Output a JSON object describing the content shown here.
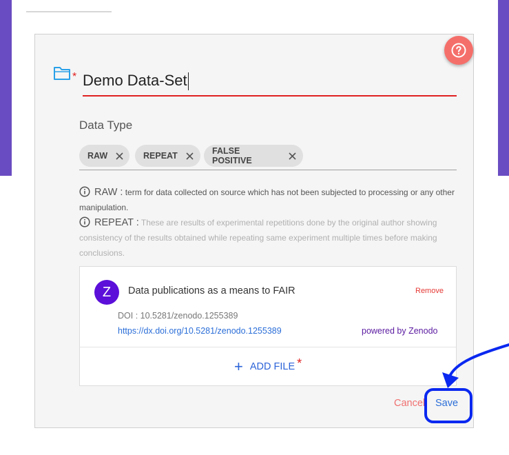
{
  "form": {
    "title_value": "Demo Data-Set",
    "datatype_label": "Data Type",
    "chips": [
      "RAW",
      "REPEAT",
      "FALSE POSITIVE"
    ]
  },
  "info": [
    {
      "term": "RAW :",
      "text": "term for data collected on source which has not been subjected to processing or any other manipulation."
    },
    {
      "term": "REPEAT :",
      "text": "These are results of experimental repetitions done by the original author showing consistency of the results obtained while repeating same experiment multiple times before making conclusions."
    }
  ],
  "file": {
    "avatar_letter": "Z",
    "title": "Data publications as a means to FAIR",
    "remove_label": "Remove",
    "doi": "DOI : 10.5281/zenodo.1255389",
    "link": "https://dx.doi.org/10.5281/zenodo.1255389",
    "powered_by": "powered by Zenodo",
    "add_label": "ADD FILE"
  },
  "actions": {
    "cancel_label": "Cancel",
    "save_label": "Save"
  },
  "colors": {
    "header_purple": "#6a4cc2",
    "help_button": "#f56f6a",
    "required_red": "#e02020",
    "link_blue": "#2b6ed8",
    "annotation_blue": "#0a28f0",
    "zenodo_purple": "#5b0fd9"
  },
  "icons": [
    "help-icon",
    "folder-icon",
    "close-icon",
    "info-icon",
    "plus-icon"
  ]
}
